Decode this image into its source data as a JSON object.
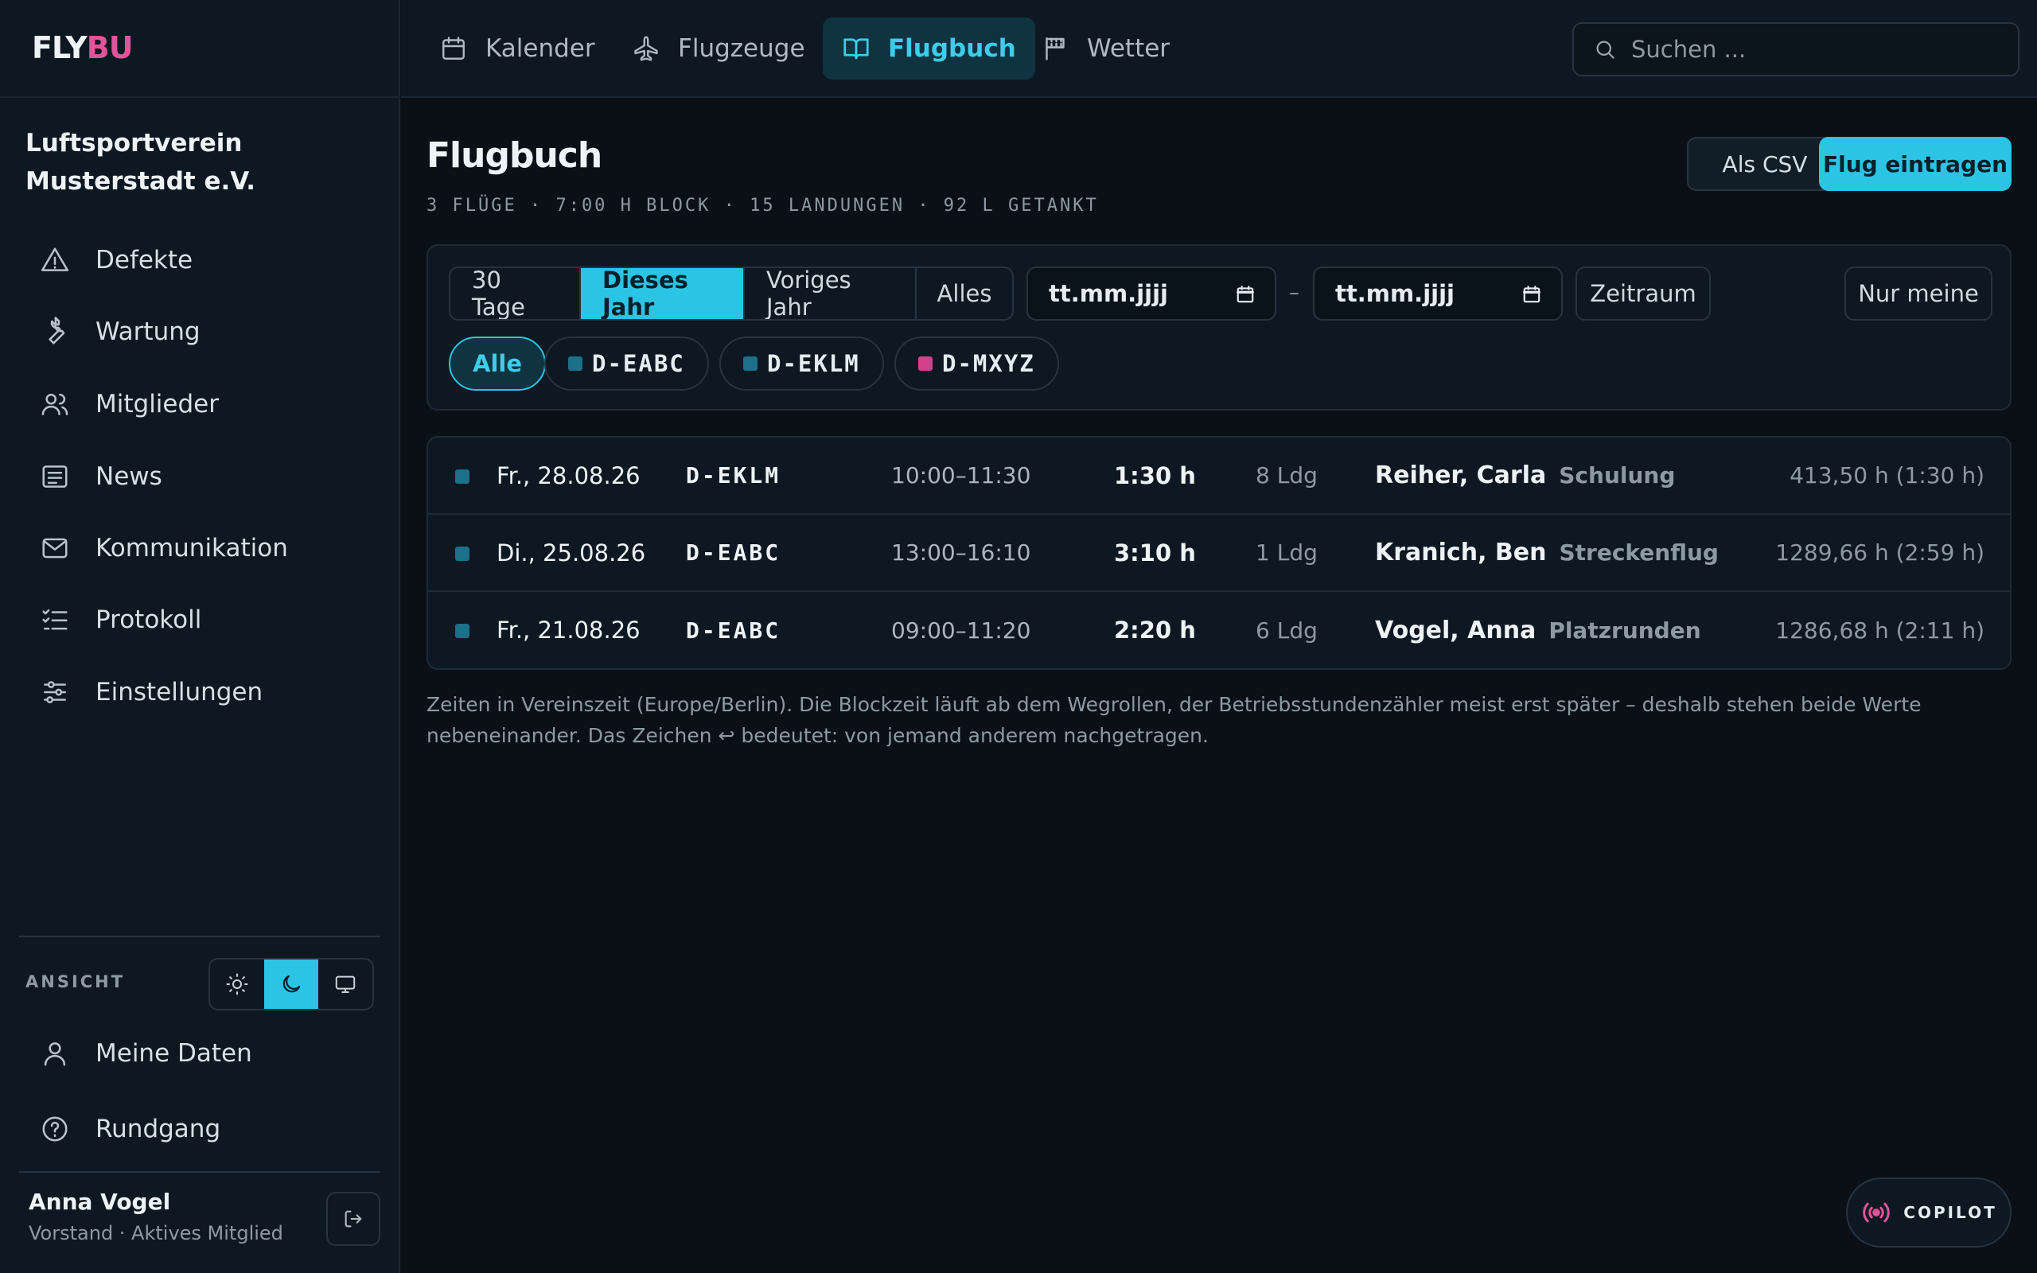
{
  "brand": {
    "logo_part1": "FLY",
    "logo_part2": "BU"
  },
  "club": {
    "name": "Luftsportverein Musterstadt e.V."
  },
  "sidebar": {
    "items": [
      {
        "label": "Defekte",
        "icon": "warning-icon"
      },
      {
        "label": "Wartung",
        "icon": "wrench-icon"
      },
      {
        "label": "Mitglieder",
        "icon": "users-icon"
      },
      {
        "label": "News",
        "icon": "news-icon"
      },
      {
        "label": "Kommunikation",
        "icon": "mail-icon"
      },
      {
        "label": "Protokoll",
        "icon": "list-check-icon"
      },
      {
        "label": "Einstellungen",
        "icon": "sliders-icon"
      }
    ],
    "view_label": "ANSICHT",
    "theme_selected": "dark",
    "bottom_items": [
      {
        "label": "Meine Daten",
        "icon": "user-icon"
      },
      {
        "label": "Rundgang",
        "icon": "help-icon"
      }
    ],
    "user": {
      "name": "Anna Vogel",
      "role": "Vorstand · Aktives Mitglied"
    }
  },
  "topbar": {
    "tabs": [
      {
        "label": "Kalender",
        "icon": "calendar-icon",
        "active": false
      },
      {
        "label": "Flugzeuge",
        "icon": "plane-icon",
        "active": false
      },
      {
        "label": "Flugbuch",
        "icon": "book-icon",
        "active": true
      },
      {
        "label": "Wetter",
        "icon": "flag-icon",
        "active": false
      }
    ],
    "search_placeholder": "Suchen ..."
  },
  "page": {
    "title": "Flugbuch",
    "stats": "3 FLÜGE · 7:00 H BLOCK · 15 LANDUNGEN · 92 L GETANKT",
    "csv_button": "Als CSV",
    "add_button": "Flug eintragen"
  },
  "filters": {
    "periods": [
      "30 Tage",
      "Dieses Jahr",
      "Voriges Jahr",
      "Alles"
    ],
    "period_selected": "Dieses Jahr",
    "date_from_placeholder": "tt.mm.jjjj",
    "date_to_placeholder": "tt.mm.jjjj",
    "date_separator": "–",
    "range_button": "Zeitraum",
    "mine_button": "Nur meine",
    "aircraft_chips": [
      {
        "label": "Alle",
        "color": null,
        "active": true
      },
      {
        "label": "D-EABC",
        "color": "#1d6f8a",
        "active": false
      },
      {
        "label": "D-EKLM",
        "color": "#1d6f8a",
        "active": false
      },
      {
        "label": "D-MXYZ",
        "color": "#d2428a",
        "active": false
      }
    ]
  },
  "flights": [
    {
      "color": "#1d6f8a",
      "date": "Fr., 28.08.26",
      "registration": "D-EKLM",
      "time": "10:00–11:30",
      "duration": "1:30 h",
      "landings": "8 Ldg",
      "pilot": "Reiher, Carla",
      "type": "Schulung",
      "hours": "413,50 h (1:30 h)"
    },
    {
      "color": "#1d6f8a",
      "date": "Di., 25.08.26",
      "registration": "D-EABC",
      "time": "13:00–16:10",
      "duration": "3:10 h",
      "landings": "1 Ldg",
      "pilot": "Kranich, Ben",
      "type": "Streckenflug",
      "hours": "1289,66 h (2:59 h)"
    },
    {
      "color": "#1d6f8a",
      "date": "Fr., 21.08.26",
      "registration": "D-EABC",
      "time": "09:00–11:20",
      "duration": "2:20 h",
      "landings": "6 Ldg",
      "pilot": "Vogel, Anna",
      "type": "Platzrunden",
      "hours": "1286,68 h (2:11 h)"
    }
  ],
  "footnote": "Zeiten in Vereinszeit (Europe/Berlin). Die Blockzeit läuft ab dem Wegrollen, der Betriebsstundenzähler meist erst später – deshalb stehen beide Werte nebeneinander. Das Zeichen ↩ bedeutet: von jemand anderem nachgetragen.",
  "copilot": {
    "label": "COPILOT",
    "icon": "broadcast-icon"
  },
  "colors": {
    "accent": "#2bc4e4",
    "brand_pink": "#e0549a",
    "background": "#0a1016",
    "panel": "#0e1822"
  }
}
